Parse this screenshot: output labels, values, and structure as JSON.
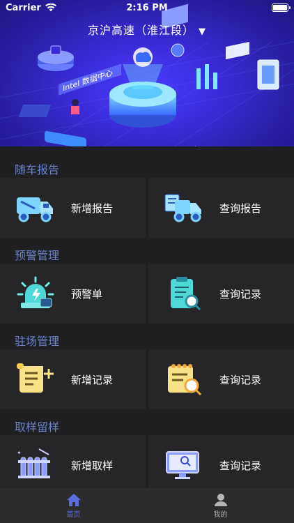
{
  "status": {
    "carrier": "Carrier",
    "time": "2:16 PM"
  },
  "header": {
    "road_name": "京沪高速（淮江段）",
    "caret": "▼"
  },
  "sections": [
    {
      "title": "随车报告",
      "items": [
        {
          "label": "新增报告",
          "icon": "truck-icon"
        },
        {
          "label": "查询报告",
          "icon": "truck-report-icon"
        }
      ]
    },
    {
      "title": "预警管理",
      "items": [
        {
          "label": "预警单",
          "icon": "alarm-light-icon"
        },
        {
          "label": "查询记录",
          "icon": "clipboard-search-icon"
        }
      ]
    },
    {
      "title": "驻场管理",
      "items": [
        {
          "label": "新增记录",
          "icon": "scroll-add-icon"
        },
        {
          "label": "查询记录",
          "icon": "notepad-search-icon"
        }
      ]
    },
    {
      "title": "取样留样",
      "items": [
        {
          "label": "新增取样",
          "icon": "test-tubes-icon"
        },
        {
          "label": "查询记录",
          "icon": "monitor-search-icon"
        }
      ]
    }
  ],
  "tabs": [
    {
      "label": "首页",
      "icon": "home-icon"
    },
    {
      "label": "我的",
      "icon": "user-icon"
    }
  ],
  "colors": {
    "accent": "#5a6ee0",
    "section_title": "#6a83c9",
    "card_bg": "#262628",
    "page_bg": "#1f1f21"
  }
}
